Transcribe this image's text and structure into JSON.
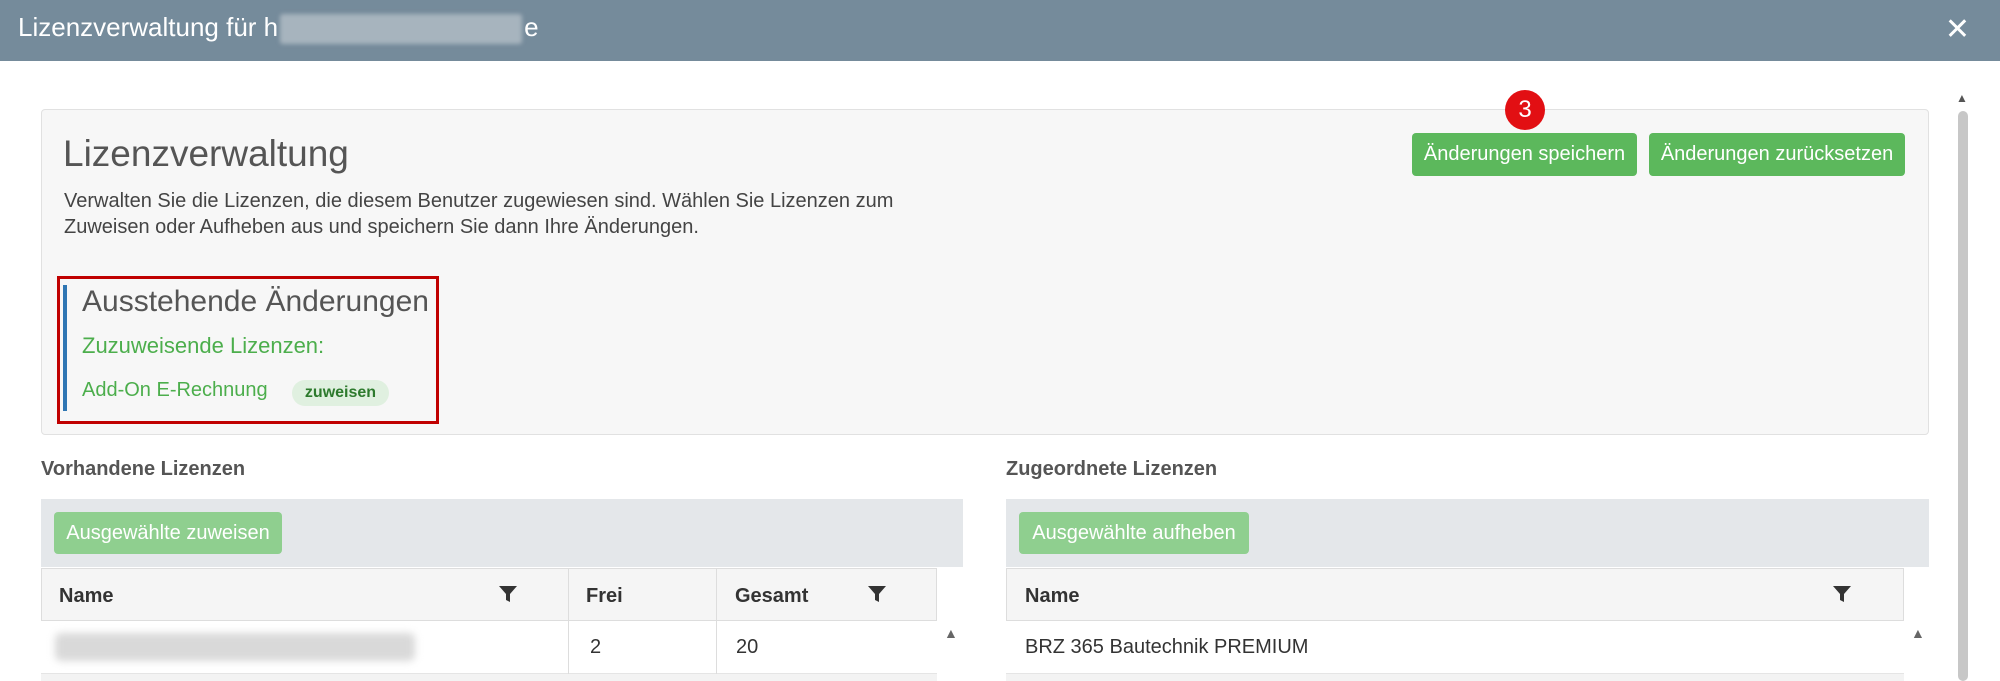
{
  "dialog": {
    "title_prefix": "Lizenzverwaltung für h",
    "title_suffix": "e",
    "close_glyph": "✕"
  },
  "panel": {
    "heading": "Lizenzverwaltung",
    "description": "Verwalten Sie die Lizenzen, die diesem Benutzer zugewiesen sind. Wählen Sie Lizenzen zum Zuweisen oder Aufheben aus und speichern Sie dann Ihre Änderungen.",
    "save_label": "Änderungen speichern",
    "reset_label": "Änderungen zurücksetzen",
    "step_number": "3"
  },
  "pending": {
    "title": "Ausstehende Änderungen",
    "subtitle": "Zuzuweisende Lizenzen:",
    "item": "Add-On E-Rechnung",
    "badge": "zuweisen"
  },
  "available": {
    "section_title": "Vorhandene Lizenzen",
    "action_label": "Ausgewählte zuweisen",
    "columns": [
      "Name",
      "Frei",
      "Gesamt"
    ],
    "rows": [
      {
        "name": "",
        "free": "2",
        "total": "20"
      }
    ]
  },
  "assigned": {
    "section_title": "Zugeordnete Lizenzen",
    "action_label": "Ausgewählte aufheben",
    "columns": [
      "Name"
    ],
    "rows": [
      {
        "name": "BRZ 365 Bautechnik PREMIUM"
      }
    ]
  },
  "icons": {
    "filter": "filter-icon",
    "close": "close-icon",
    "scroll_up": "scroll-up-icon"
  },
  "colors": {
    "titlebar": "#758b9b",
    "primary_green": "#5cb85c",
    "disabled_green": "#8fcf8f",
    "badge_red": "#e20f13",
    "highlight_border": "#c00000",
    "pending_accent": "#2f76b3"
  }
}
